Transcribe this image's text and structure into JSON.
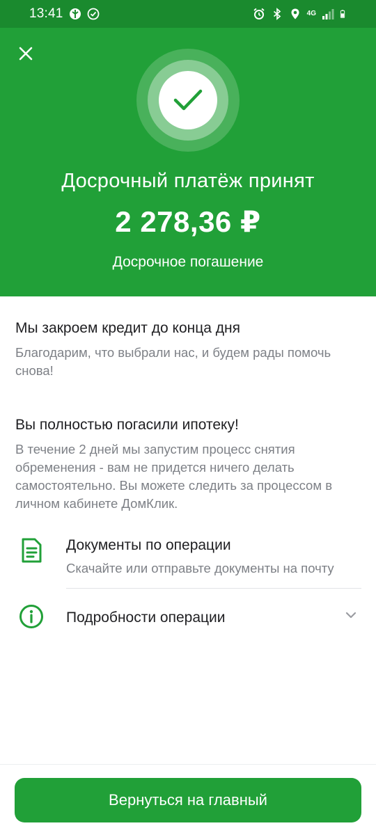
{
  "status_bar": {
    "time": "13:41",
    "signal_label": "4G"
  },
  "colors": {
    "brand_green": "#21a038",
    "status_green": "#1a8a2e",
    "secondary_text": "#7d8086"
  },
  "header": {
    "close_icon": "close-icon",
    "success_icon": "checkmark-icon",
    "title": "Досрочный платёж принят",
    "amount": "2 278,36 ₽",
    "subtitle": "Досрочное погашение"
  },
  "blocks": [
    {
      "title": "Мы закроем кредит до конца дня",
      "text": "Благодарим, что выбрали нас, и будем рады помочь снова!"
    },
    {
      "title": "Вы полностью погасили ипотеку!",
      "text": "В течение 2 дней мы запустим процесс снятия обременения - вам не придется ничего делать самостоятельно. Вы можете следить за процессом в личном кабинете ДомКлик."
    }
  ],
  "list": {
    "documents": {
      "icon": "document-icon",
      "title": "Документы по операции",
      "subtitle": "Скачайте или отправьте документы на почту"
    },
    "details": {
      "icon": "info-icon",
      "title": "Подробности операции",
      "chevron": "chevron-down-icon"
    }
  },
  "footer": {
    "button_label": "Вернуться на главный"
  }
}
